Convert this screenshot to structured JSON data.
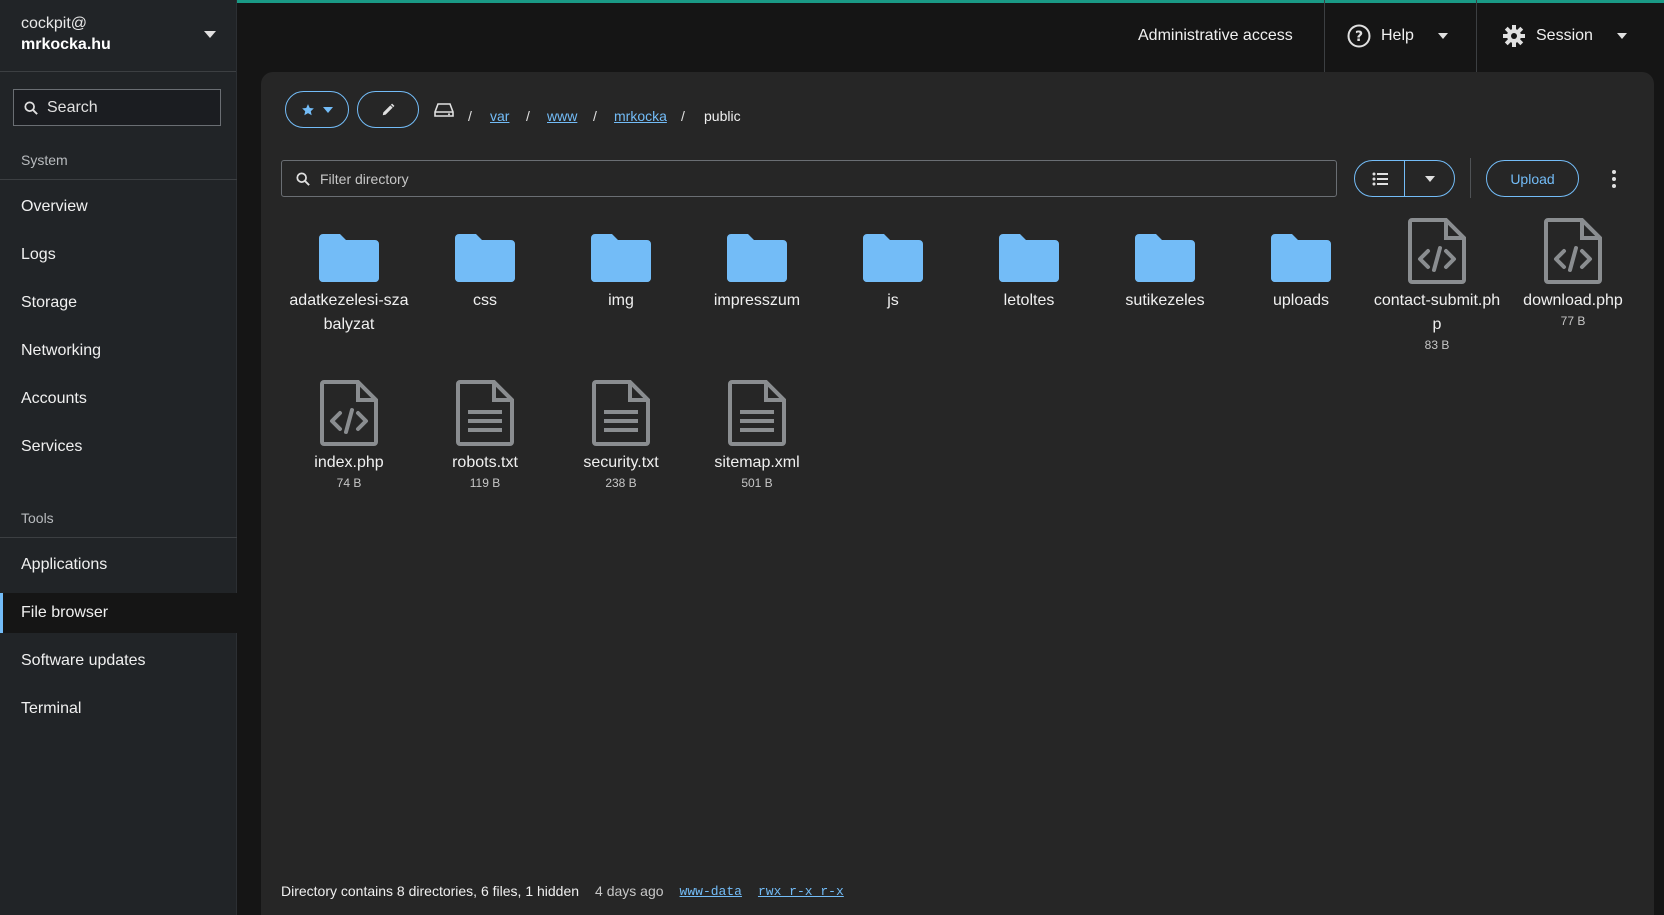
{
  "host": {
    "user": "cockpit@",
    "name": "mrkocka.hu"
  },
  "sidebar": {
    "search_label": "Search",
    "system_title": "System",
    "tools_title": "Tools",
    "system_items": [
      "Overview",
      "Logs",
      "Storage",
      "Networking",
      "Accounts",
      "Services"
    ],
    "tools_items": [
      "Applications",
      "File browser",
      "Software updates",
      "Terminal"
    ],
    "active": "File browser"
  },
  "topbar": {
    "admin": "Administrative access",
    "help": "Help",
    "session": "Session"
  },
  "breadcrumb": {
    "parts": [
      "var",
      "www",
      "mrkocka"
    ],
    "current": "public",
    "separator": "/"
  },
  "filter": {
    "placeholder": "Filter directory"
  },
  "toolbar": {
    "upload": "Upload"
  },
  "items": [
    {
      "name": "adatkezelesi-szabalyzat",
      "type": "folder",
      "size": ""
    },
    {
      "name": "css",
      "type": "folder",
      "size": ""
    },
    {
      "name": "img",
      "type": "folder",
      "size": ""
    },
    {
      "name": "impresszum",
      "type": "folder",
      "size": ""
    },
    {
      "name": "js",
      "type": "folder",
      "size": ""
    },
    {
      "name": "letoltes",
      "type": "folder",
      "size": ""
    },
    {
      "name": "sutikezeles",
      "type": "folder",
      "size": ""
    },
    {
      "name": "uploads",
      "type": "folder",
      "size": ""
    },
    {
      "name": "contact-submit.php",
      "type": "code",
      "size": "83 B"
    },
    {
      "name": "download.php",
      "type": "code",
      "size": "77 B"
    },
    {
      "name": "index.php",
      "type": "code",
      "size": "74 B"
    },
    {
      "name": "robots.txt",
      "type": "text",
      "size": "119 B"
    },
    {
      "name": "security.txt",
      "type": "text",
      "size": "238 B"
    },
    {
      "name": "sitemap.xml",
      "type": "text",
      "size": "501 B"
    }
  ],
  "status": {
    "summary": "Directory contains 8 directories, 6 files, 1 hidden",
    "modified": "4 days ago",
    "owner": "www-data",
    "perms": "rwx r-x r-x"
  },
  "colors": {
    "accent": "#73bcf7",
    "folder": "#73bcf7",
    "file": "#8a8d90",
    "progress": "#1a9a86"
  }
}
